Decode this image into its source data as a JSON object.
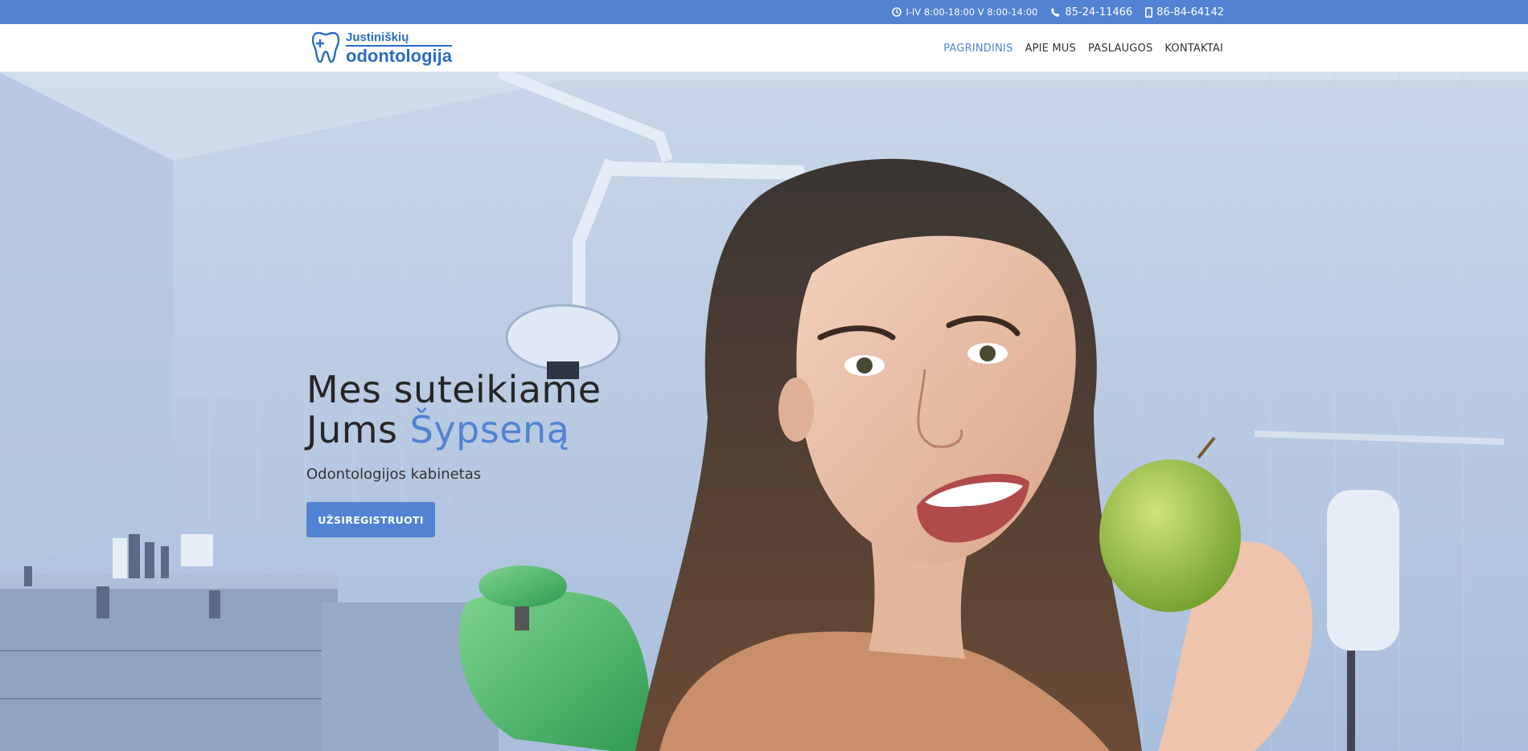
{
  "topbar": {
    "hours": "I-IV 8:00-18:00 V 8:00-14:00",
    "phone": "85-24-11466",
    "mobile": "86-84-64142",
    "icons": [
      "clock-icon",
      "phone-icon",
      "mobile-icon"
    ]
  },
  "logo": {
    "line1": "Justiniškių",
    "line2": "odontologija"
  },
  "nav": {
    "items": [
      {
        "label": "PAGRINDINIS",
        "active": true
      },
      {
        "label": "APIE MUS",
        "active": false
      },
      {
        "label": "PASLAUGOS",
        "active": false
      },
      {
        "label": "KONTAKTAI",
        "active": false
      }
    ]
  },
  "hero": {
    "headline_line1": "Mes suteikiame",
    "headline_line2_plain": "Jums",
    "headline_line2_accent": "Šypseną",
    "subtitle": "Odontologijos kabinetas",
    "cta_label": "UŽSIREGISTRUOTI"
  },
  "colors": {
    "brand_blue": "#5282d2",
    "logo_blue": "#2a6cc6",
    "text_dark": "#262626"
  }
}
